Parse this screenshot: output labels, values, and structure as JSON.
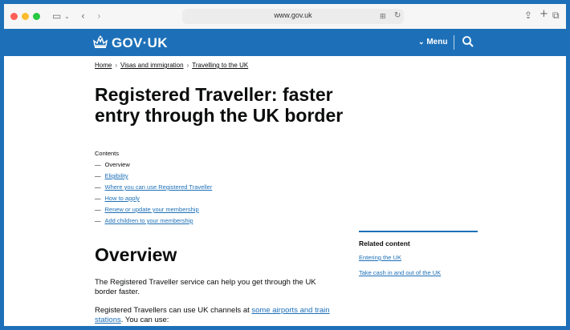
{
  "browser": {
    "url": "www.gov.uk",
    "traffic_lights": [
      "#ff5f57",
      "#febc2e",
      "#28c840"
    ]
  },
  "header": {
    "logo_text": "GOV·UK",
    "menu_label": "Menu",
    "brand_color": "#1d70b8"
  },
  "breadcrumbs": [
    {
      "label": "Home"
    },
    {
      "label": "Visas and immigration"
    },
    {
      "label": "Travelling to the UK"
    }
  ],
  "page_title": "Registered Traveller: faster entry through the UK border",
  "contents": {
    "title": "Contents",
    "items": [
      {
        "label": "Overview",
        "current": true
      },
      {
        "label": "Eligibility"
      },
      {
        "label": "Where you can use Registered Traveller"
      },
      {
        "label": "How to apply"
      },
      {
        "label": "Renew or update your membership"
      },
      {
        "label": "Add children to your membership"
      }
    ]
  },
  "related": {
    "title": "Related content",
    "links": [
      "Entering the UK",
      "Take cash in and out of the UK"
    ]
  },
  "section": {
    "heading": "Overview",
    "para1": "The Registered Traveller service can help you get through the UK border faster.",
    "para2_before": "Registered Travellers can use UK channels at ",
    "para2_link": "some airports and train stations",
    "para2_after": ". You can use:"
  }
}
